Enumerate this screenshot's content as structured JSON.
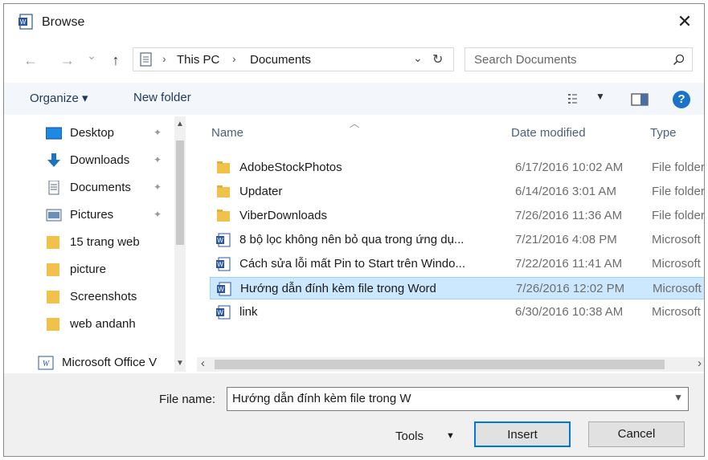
{
  "dialog": {
    "title": "Browse",
    "close_glyph": "✕"
  },
  "address": {
    "back_glyph": "←",
    "forward_glyph": "→",
    "recent_glyph": "⌄",
    "up_glyph": "↑",
    "crumbs": [
      "This PC",
      "Documents"
    ],
    "separator": "›",
    "dropdown_glyph": "⌄",
    "refresh_glyph": "↻"
  },
  "search": {
    "placeholder": "Search Documents",
    "icon": "search-icon"
  },
  "toolbar": {
    "organize_label": "Organize ▾",
    "new_folder_label": "New folder",
    "view_icon": "view-options-icon",
    "preview_icon": "preview-pane-icon",
    "help_label": "?"
  },
  "nav": {
    "items": [
      {
        "label": "Desktop",
        "icon": "desktop-icon",
        "pinned": true
      },
      {
        "label": "Downloads",
        "icon": "downloads-icon",
        "pinned": true
      },
      {
        "label": "Documents",
        "icon": "documents-icon",
        "pinned": true
      },
      {
        "label": "Pictures",
        "icon": "pictures-icon",
        "pinned": true
      },
      {
        "label": "15 trang web",
        "icon": "folder-icon",
        "pinned": false
      },
      {
        "label": "picture",
        "icon": "folder-icon",
        "pinned": false
      },
      {
        "label": "Screenshots",
        "icon": "folder-icon",
        "pinned": false
      },
      {
        "label": "web andanh",
        "icon": "folder-icon",
        "pinned": false
      },
      {
        "label": "Microsoft Office V",
        "icon": "office-icon",
        "pinned": false
      }
    ],
    "pin_glyph": "✦"
  },
  "files": {
    "columns": [
      "Name",
      "Date modified",
      "Type"
    ],
    "rows": [
      {
        "name": "AdobeStockPhotos",
        "date": "6/17/2016 10:02 AM",
        "type": "File folder",
        "kind": "folder"
      },
      {
        "name": "Updater",
        "date": "6/14/2016 3:01 AM",
        "type": "File folder",
        "kind": "folder"
      },
      {
        "name": "ViberDownloads",
        "date": "7/26/2016 11:36 AM",
        "type": "File folder",
        "kind": "folder"
      },
      {
        "name": "8 bộ lọc không nên bỏ qua trong ứng dụ...",
        "date": "7/21/2016 4:08 PM",
        "type": "Microsoft",
        "kind": "word"
      },
      {
        "name": "Cách sửa lỗi mất Pin to Start trên Windo...",
        "date": "7/22/2016 11:41 AM",
        "type": "Microsoft",
        "kind": "word"
      },
      {
        "name": "Hướng dẫn đính kèm file trong Word",
        "date": "7/26/2016 12:02 PM",
        "type": "Microsoft",
        "kind": "word",
        "selected": true
      },
      {
        "name": "link",
        "date": "6/30/2016 10:38 AM",
        "type": "Microsoft",
        "kind": "word"
      }
    ],
    "scroll_left_glyph": "‹",
    "scroll_right_glyph": "›"
  },
  "bottom": {
    "file_name_label": "File name:",
    "file_name_value": "Hướng dẫn đính kèm file trong W",
    "tools_label": "Tools",
    "insert_label": "Insert",
    "cancel_label": "Cancel"
  },
  "colors": {
    "selection": "#cce8ff",
    "accent": "#0078d7",
    "folder": "#f0c24b",
    "word": "#2b579a"
  }
}
